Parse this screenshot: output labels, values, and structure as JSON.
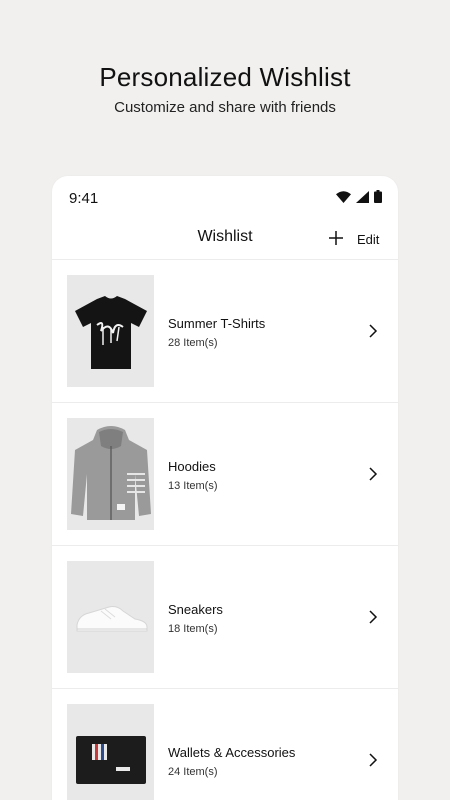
{
  "promo": {
    "title": "Personalized Wishlist",
    "subtitle": "Customize and share with friends"
  },
  "status_bar": {
    "time": "9:41",
    "icons": [
      "wifi-icon",
      "signal-icon",
      "battery-icon"
    ]
  },
  "nav": {
    "title": "Wishlist",
    "add_icon": "plus-icon",
    "edit_label": "Edit"
  },
  "wishlists": [
    {
      "name": "Summer T-Shirts",
      "count": "28 Item(s)",
      "image": "black-tshirt"
    },
    {
      "name": "Hoodies",
      "count": "13 Item(s)",
      "image": "grey-hoodie"
    },
    {
      "name": "Sneakers",
      "count": "18 Item(s)",
      "image": "white-sneaker"
    },
    {
      "name": "Wallets & Accessories",
      "count": "24 Item(s)",
      "image": "card-wallet"
    }
  ],
  "colors": {
    "background": "#f1f0ee",
    "card": "#ffffff",
    "thumb_bg": "#e8e8e8",
    "text": "#111111"
  }
}
